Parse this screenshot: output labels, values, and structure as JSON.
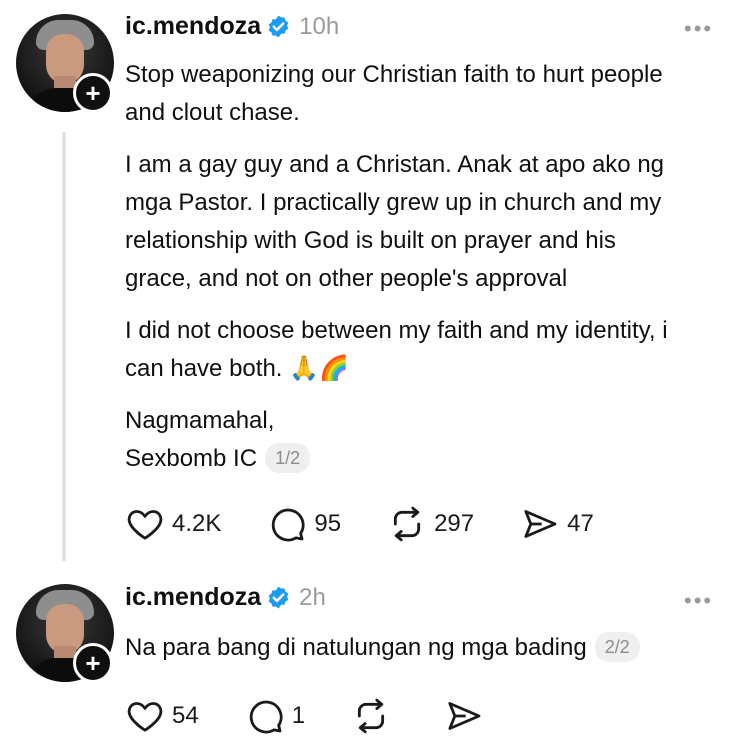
{
  "posts": [
    {
      "username": "ic.mendoza",
      "time": "10h",
      "paragraphs": [
        [
          "Stop weaponizing our Christian faith to hurt people",
          "and clout chase."
        ],
        [
          "I am a gay guy and a Christan. Anak at apo ako ng",
          "mga Pastor. I practically grew up in church and my",
          "relationship with God is built on prayer and his",
          "grace, and not on other people's approval"
        ],
        [
          "I did not choose between my faith and my identity, i",
          "can have both. 🙏🌈"
        ],
        [
          "Nagmamahal,",
          "Sexbomb IC"
        ]
      ],
      "pager": "1/2",
      "likes": "4.2K",
      "replies": "95",
      "reposts": "297",
      "shares": "47"
    },
    {
      "username": "ic.mendoza",
      "time": "2h",
      "text": "Na para bang di natulungan ng mga bading",
      "pager": "2/2",
      "likes": "54",
      "replies": "1",
      "reposts": "",
      "shares": ""
    }
  ],
  "icons": {
    "verified": "verified-badge-icon",
    "more": "more-options-icon",
    "like": "heart-icon",
    "reply": "comment-icon",
    "repost": "repost-icon",
    "share": "send-icon",
    "follow": "plus-icon"
  },
  "colors": {
    "verified": "#1d9bf0",
    "muted": "#9a9a9a",
    "text": "#101010"
  }
}
